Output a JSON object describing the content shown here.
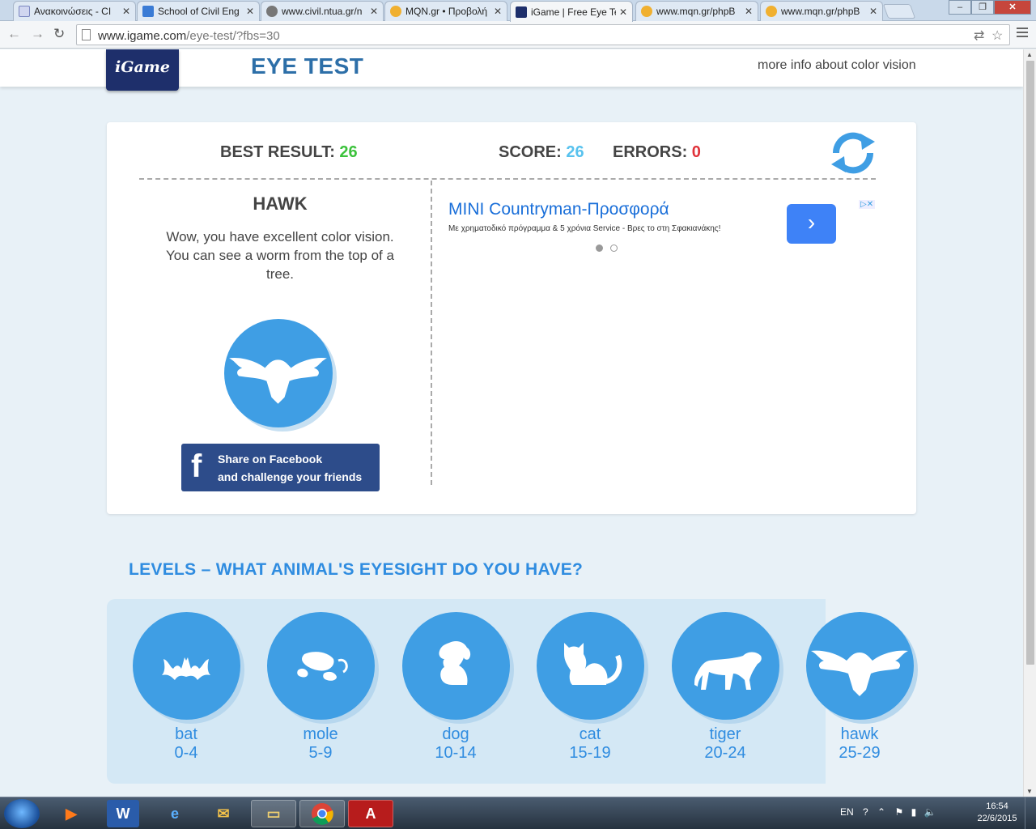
{
  "browser": {
    "tabs": [
      {
        "label": "Ανακοινώσεις - CI",
        "fav_color": "#d0d6f0"
      },
      {
        "label": "School of Civil Eng",
        "fav_color": "#3a7bd5"
      },
      {
        "label": "www.civil.ntua.gr/n",
        "fav_color": "#777777"
      },
      {
        "label": "MQN.gr • Προβολή",
        "fav_color": "#f0b030"
      },
      {
        "label": "iGame | Free Eye Te",
        "fav_color": "#1e2f6b"
      },
      {
        "label": "www.mqn.gr/phpB",
        "fav_color": "#f0b030"
      },
      {
        "label": "www.mqn.gr/phpB",
        "fav_color": "#f0b030"
      }
    ],
    "url_host": "www.igame.com",
    "url_path": "/eye-test/?fbs=30"
  },
  "header": {
    "logo": "iGame",
    "title": "EYE TEST",
    "more_info": "more info about color vision"
  },
  "stats": {
    "best_label": "BEST RESULT:",
    "best_value": "26",
    "score_label": "SCORE:",
    "score_value": "26",
    "errors_label": "ERRORS:",
    "errors_value": "0"
  },
  "result": {
    "animal": "HAWK",
    "description": "Wow, you have excellent color vision. You can see a worm from the top of a tree."
  },
  "facebook": {
    "line1": "Share on Facebook",
    "line2": "and challenge your friends"
  },
  "ad": {
    "title": "MINI Countryman-Προσφορά",
    "subtitle": "Με χρηματοδικό πρόγραμμα & 5 χρόνια Service - Βρες το στη Σφακιανάκης!",
    "arrow": "›"
  },
  "levels": {
    "title": "LEVELS – WHAT ANIMAL'S EYESIGHT DO YOU HAVE?",
    "items": [
      {
        "name": "bat",
        "range": "0-4",
        "icon": "bat-icon"
      },
      {
        "name": "mole",
        "range": "5-9",
        "icon": "mole-icon"
      },
      {
        "name": "dog",
        "range": "10-14",
        "icon": "dog-icon"
      },
      {
        "name": "cat",
        "range": "15-19",
        "icon": "cat-icon"
      },
      {
        "name": "tiger",
        "range": "20-24",
        "icon": "tiger-icon"
      },
      {
        "name": "hawk",
        "range": "25-29",
        "icon": "hawk-icon"
      }
    ]
  },
  "taskbar": {
    "lang": "EN",
    "time": "16:54",
    "date": "22/6/2015"
  },
  "colors": {
    "accent": "#2f8ce0",
    "circle": "#3f9ee4",
    "best": "#3cc23c",
    "score": "#58c2ee",
    "errors": "#e0323a"
  }
}
